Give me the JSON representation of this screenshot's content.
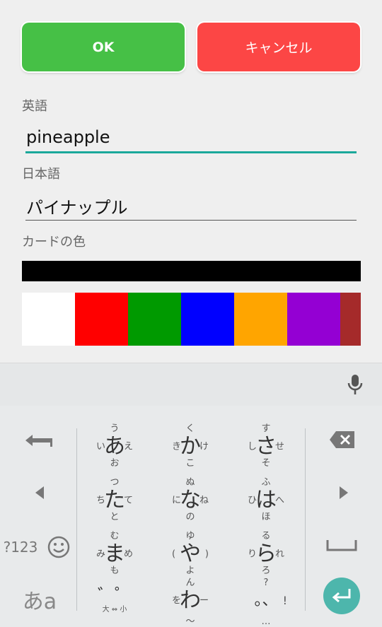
{
  "buttons": {
    "ok": "OK",
    "cancel": "キャンセル"
  },
  "fields": {
    "english": {
      "label": "英語",
      "value": "pineapple"
    },
    "japanese": {
      "label": "日本語",
      "value": "パイナップル"
    },
    "card_color": {
      "label": "カードの色",
      "selected": "#000000"
    }
  },
  "swatches": [
    "#ffffff",
    "#ff0000",
    "#009a00",
    "#0000ff",
    "#ffa500",
    "#9400d3",
    "#a52a2a"
  ],
  "accent": "#1aa89a",
  "keyboard": {
    "keys": [
      {
        "main": "あ",
        "up": "う",
        "down": "お",
        "left": "い",
        "right": "え"
      },
      {
        "main": "か",
        "up": "く",
        "down": "こ",
        "left": "き",
        "right": "け"
      },
      {
        "main": "さ",
        "up": "す",
        "down": "そ",
        "left": "し",
        "right": "せ"
      },
      {
        "main": "た",
        "up": "つ",
        "down": "と",
        "left": "ち",
        "right": "て"
      },
      {
        "main": "な",
        "up": "ぬ",
        "down": "の",
        "left": "に",
        "right": "ね"
      },
      {
        "main": "は",
        "up": "ふ",
        "down": "ほ",
        "left": "ひ",
        "right": "へ"
      },
      {
        "main": "ま",
        "up": "む",
        "down": "も",
        "left": "み",
        "right": "め"
      },
      {
        "main": "や",
        "up": "ゆ",
        "down": "よ",
        "left": "(",
        "right": ")"
      },
      {
        "main": "ら",
        "up": "る",
        "down": "ろ",
        "left": "り",
        "right": "れ"
      },
      {
        "main": "゛゜",
        "up": "",
        "down": "大 ⇔ 小",
        "left": "",
        "right": ""
      },
      {
        "main": "わ",
        "up": "ん",
        "down": "〜",
        "left": "を",
        "right": "ー"
      },
      {
        "main": "。、",
        "up": "?",
        "down": "…",
        "left": "",
        "right": "!"
      }
    ],
    "num_label": "?123",
    "kana_label": "あa"
  }
}
